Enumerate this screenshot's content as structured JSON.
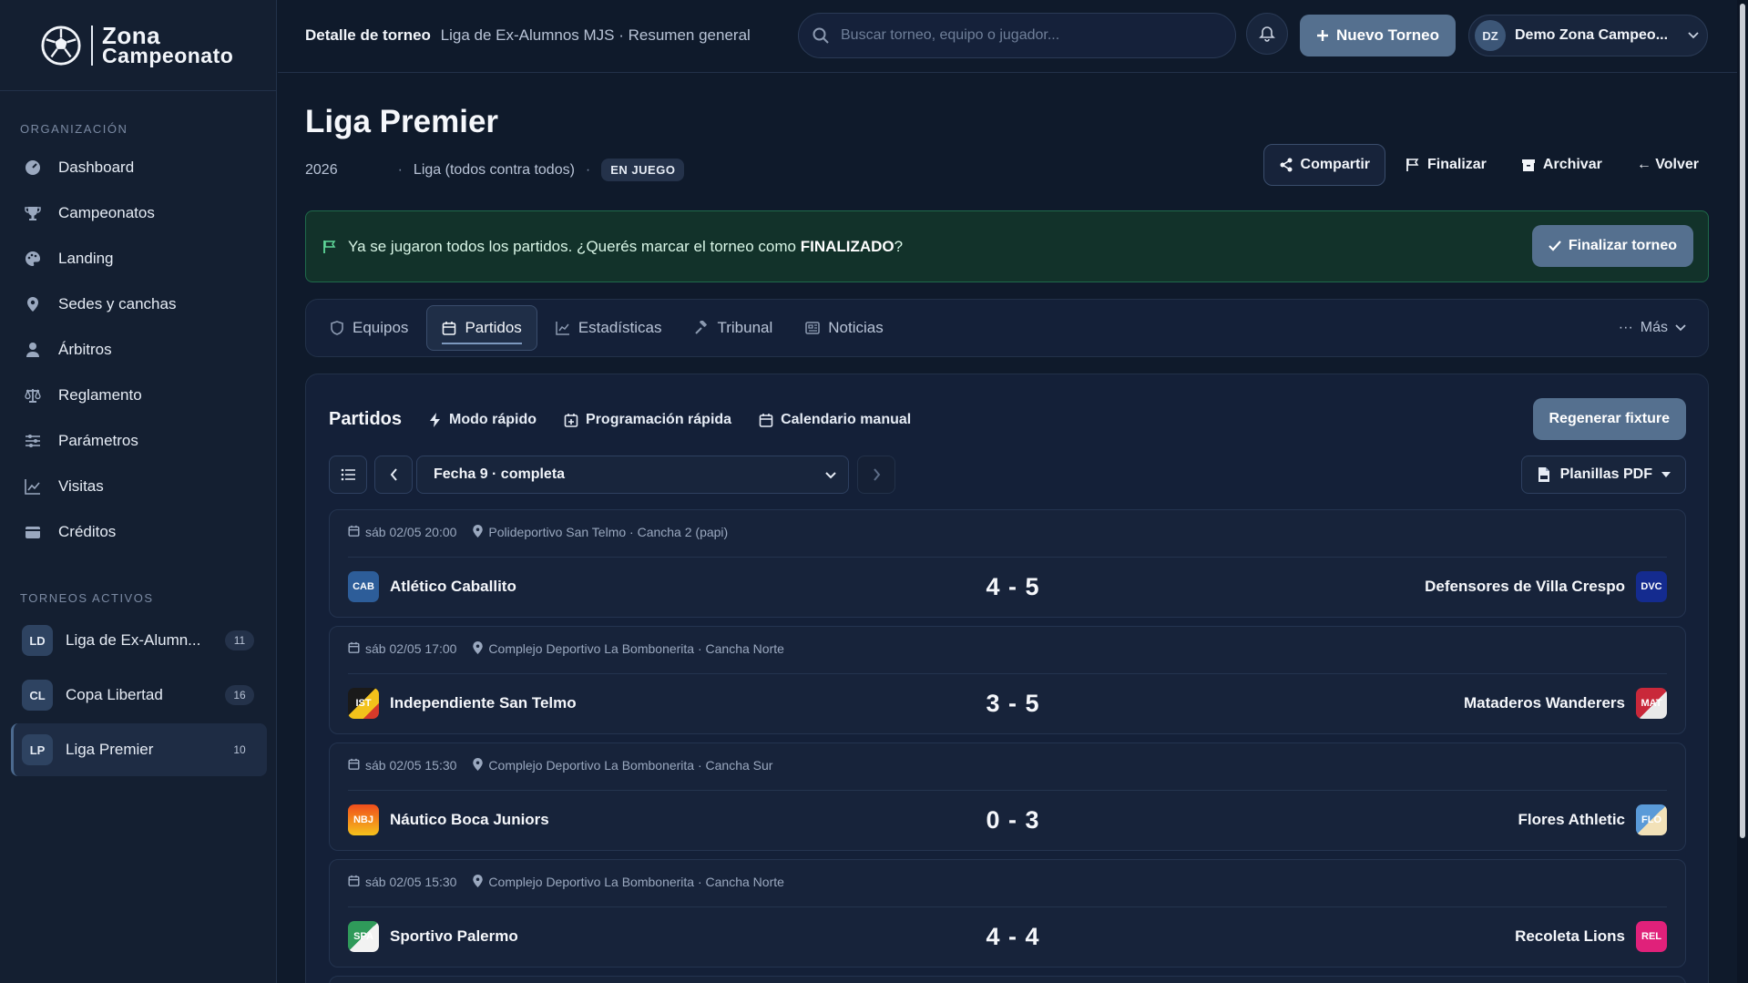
{
  "brand": {
    "line1": "Zona",
    "line2": "Campeonato"
  },
  "sidebar": {
    "section_org": "ORGANIZACIÓN",
    "items": [
      {
        "label": "Dashboard",
        "icon": "dashboard-icon"
      },
      {
        "label": "Campeonatos",
        "icon": "trophy-icon"
      },
      {
        "label": "Landing",
        "icon": "palette-icon"
      },
      {
        "label": "Sedes y canchas",
        "icon": "map-pin-icon"
      },
      {
        "label": "Árbitros",
        "icon": "user-icon"
      },
      {
        "label": "Reglamento",
        "icon": "scale-icon"
      },
      {
        "label": "Parámetros",
        "icon": "sliders-icon"
      },
      {
        "label": "Visitas",
        "icon": "chart-line-icon"
      },
      {
        "label": "Créditos",
        "icon": "wallet-icon"
      }
    ],
    "section_active": "TORNEOS ACTIVOS",
    "tournaments": [
      {
        "initials": "LD",
        "name": "Liga de Ex-Alumn...",
        "count": "11"
      },
      {
        "initials": "CL",
        "name": "Copa Libertad",
        "count": "16"
      },
      {
        "initials": "LP",
        "name": "Liga Premier",
        "count": "10"
      }
    ]
  },
  "topbar": {
    "crumb_bold": "Detalle de torneo",
    "crumb_rest": "Liga de Ex-Alumnos MJS · Resumen general",
    "search_placeholder": "Buscar torneo, equipo o jugador...",
    "new_button": "Nuevo Torneo",
    "user_initials": "DZ",
    "user_name": "Demo Zona Campeo..."
  },
  "header": {
    "title": "Liga Premier",
    "year": "2026",
    "format": "Liga (todos contra todos)",
    "status": "EN JUEGO",
    "actions": {
      "share": "Compartir",
      "finish": "Finalizar",
      "archive": "Archivar",
      "back": "← Volver"
    }
  },
  "banner": {
    "text_before": "Ya se jugaron todos los partidos. ¿Querés marcar el torneo como",
    "text_bold": "FINALIZADO",
    "text_after": "?",
    "button": "Finalizar torneo"
  },
  "tabs": {
    "items": [
      "Equipos",
      "Partidos",
      "Estadísticas",
      "Tribunal",
      "Noticias"
    ],
    "active": "Partidos",
    "more": "Más"
  },
  "panel": {
    "title": "Partidos",
    "links": [
      "Modo rápido",
      "Programación rápida",
      "Calendario manual"
    ],
    "regen_button": "Regenerar fixture",
    "round_select": "Fecha 9 · completa",
    "pdf_button": "Planillas PDF"
  },
  "matches": [
    {
      "datetime": "sáb 02/05 20:00",
      "venue": "Polideportivo San Telmo · Cancha 2 (papi)",
      "home": {
        "name": "Atlético Caballito",
        "abbr": "CAB",
        "color": "#2d5d99"
      },
      "score": "4 - 5",
      "away": {
        "name": "Defensores de Villa Crespo",
        "abbr": "DVC",
        "color": "#142b8f"
      }
    },
    {
      "datetime": "sáb 02/05 17:00",
      "venue": "Complejo Deportivo La Bombonerita · Cancha Norte",
      "home": {
        "name": "Independiente San Telmo",
        "abbr": "IST",
        "color": "#f2c21b"
      },
      "score": "3 - 5",
      "away": {
        "name": "Mataderos Wanderers",
        "abbr": "MAT",
        "color": "#c9283a"
      }
    },
    {
      "datetime": "sáb 02/05 15:30",
      "venue": "Complejo Deportivo La Bombonerita · Cancha Sur",
      "home": {
        "name": "Náutico Boca Juniors",
        "abbr": "NBJ",
        "color": "#f08a1c"
      },
      "score": "0 - 3",
      "away": {
        "name": "Flores Athletic",
        "abbr": "FLO",
        "color": "#5a9ad8"
      }
    },
    {
      "datetime": "sáb 02/05 15:30",
      "venue": "Complejo Deportivo La Bombonerita · Cancha Norte",
      "home": {
        "name": "Sportivo Palermo",
        "abbr": "SPA",
        "color": "#2f9a5a"
      },
      "score": "4 - 4",
      "away": {
        "name": "Recoleta Lions",
        "abbr": "REL",
        "color": "#e0217a"
      }
    }
  ]
}
